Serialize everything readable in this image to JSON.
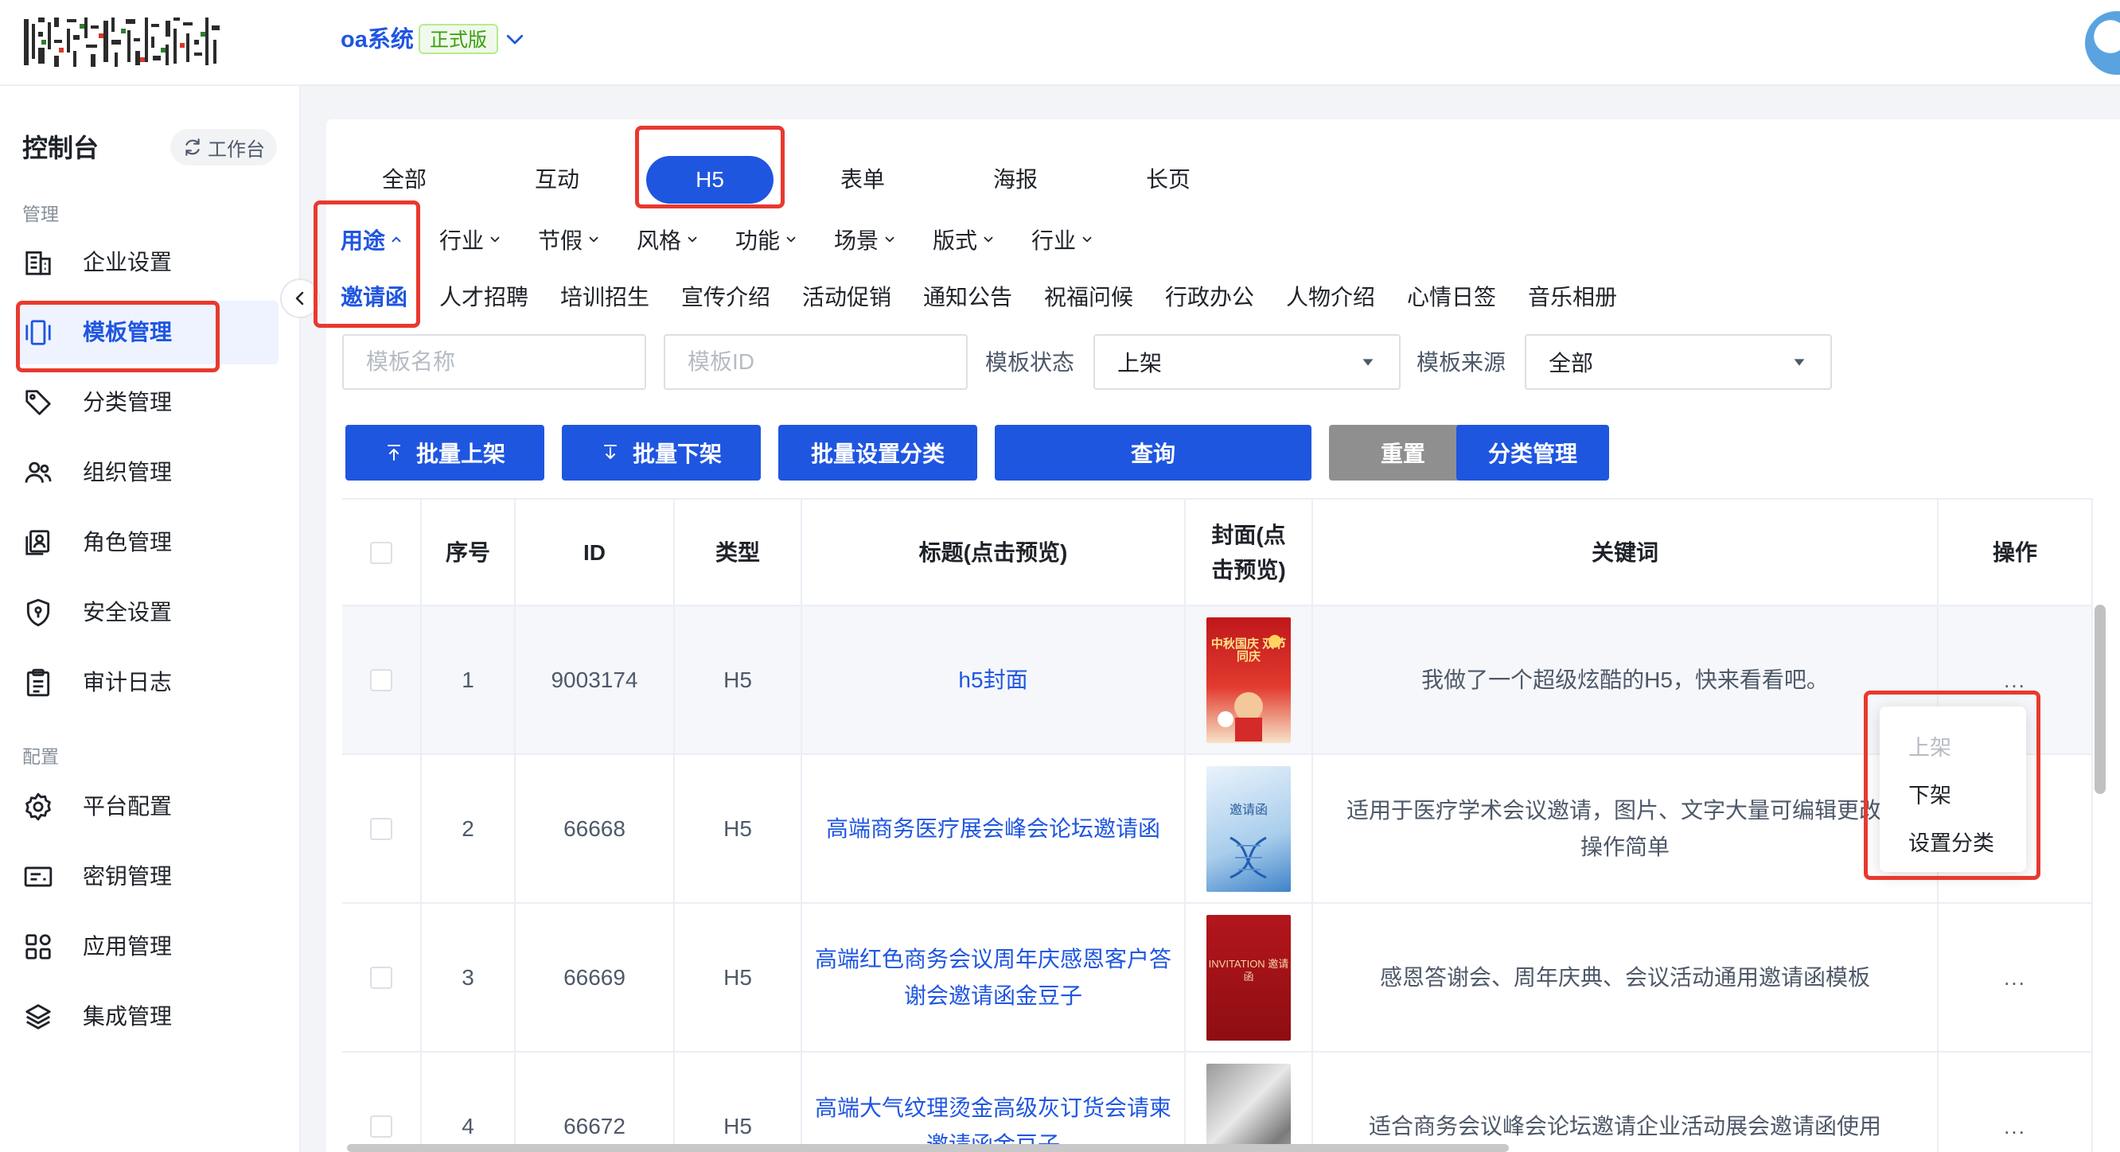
{
  "header": {
    "app_name": "oa系统",
    "edition_badge": "正式版"
  },
  "sidebar": {
    "title": "控制台",
    "workbench_label": "工作台",
    "sections": {
      "manage_label": "管理",
      "config_label": "配置"
    },
    "items": [
      {
        "label": "企业设置",
        "icon": "building-icon"
      },
      {
        "label": "模板管理",
        "icon": "template-icon",
        "active": true
      },
      {
        "label": "分类管理",
        "icon": "tag-icon"
      },
      {
        "label": "组织管理",
        "icon": "users-icon"
      },
      {
        "label": "角色管理",
        "icon": "role-icon"
      },
      {
        "label": "安全设置",
        "icon": "shield-icon"
      },
      {
        "label": "审计日志",
        "icon": "clipboard-icon"
      },
      {
        "label": "平台配置",
        "icon": "gear-icon"
      },
      {
        "label": "密钥管理",
        "icon": "key-card-icon"
      },
      {
        "label": "应用管理",
        "icon": "apps-icon"
      },
      {
        "label": "集成管理",
        "icon": "layers-icon"
      }
    ]
  },
  "type_tabs": [
    {
      "label": "全部"
    },
    {
      "label": "互动"
    },
    {
      "label": "H5",
      "active": true
    },
    {
      "label": "表单"
    },
    {
      "label": "海报"
    },
    {
      "label": "长页"
    }
  ],
  "filter_dropdowns": [
    {
      "label": "用途",
      "active": true
    },
    {
      "label": "行业"
    },
    {
      "label": "节假"
    },
    {
      "label": "风格"
    },
    {
      "label": "功能"
    },
    {
      "label": "场景"
    },
    {
      "label": "版式"
    },
    {
      "label": "行业"
    }
  ],
  "sub_tags": [
    {
      "label": "邀请函",
      "active": true
    },
    {
      "label": "人才招聘"
    },
    {
      "label": "培训招生"
    },
    {
      "label": "宣传介绍"
    },
    {
      "label": "活动促销"
    },
    {
      "label": "通知公告"
    },
    {
      "label": "祝福问候"
    },
    {
      "label": "行政办公"
    },
    {
      "label": "人物介绍"
    },
    {
      "label": "心情日签"
    },
    {
      "label": "音乐相册"
    }
  ],
  "search": {
    "name_placeholder": "模板名称",
    "id_placeholder": "模板ID",
    "status_label": "模板状态",
    "status_value": "上架",
    "source_label": "模板来源",
    "source_value": "全部"
  },
  "actions": {
    "batch_on": "批量上架",
    "batch_off": "批量下架",
    "batch_category": "批量设置分类",
    "query": "查询",
    "reset": "重置",
    "category_manage": "分类管理"
  },
  "table": {
    "columns": {
      "seq": "序号",
      "id": "ID",
      "type": "类型",
      "title": "标题(点击预览)",
      "cover": "封面(点击预览)",
      "keywords": "关键词",
      "ops": "操作"
    },
    "rows": [
      {
        "seq": "1",
        "id": "9003174",
        "type": "H5",
        "title": "h5封面",
        "keywords": "我做了一个超级炫酷的H5，快来看看吧。",
        "ops": "...",
        "cover_text": "中秋国庆 双节同庆"
      },
      {
        "seq": "2",
        "id": "66668",
        "type": "H5",
        "title": "高端商务医疗展会峰会论坛邀请函",
        "keywords": "适用于医疗学术会议邀请，图片、文字大量可编辑更改，操作简单",
        "ops": "",
        "cover_text": "邀请函"
      },
      {
        "seq": "3",
        "id": "66669",
        "type": "H5",
        "title": "高端红色商务会议周年庆感恩客户答谢会邀请函金豆子",
        "keywords": "感恩答谢会、周年庆典、会议活动通用邀请函模板",
        "ops": "...",
        "cover_text": "INVITATION 邀请函"
      },
      {
        "seq": "4",
        "id": "66672",
        "type": "H5",
        "title": "高端大气纹理烫金高级灰订货会请柬邀请函金豆子",
        "keywords": "适合商务会议峰会论坛邀请企业活动展会邀请函使用",
        "ops": "...",
        "cover_text": ""
      }
    ]
  },
  "op_menu": {
    "items": [
      {
        "label": "上架",
        "disabled": true
      },
      {
        "label": "下架"
      },
      {
        "label": "设置分类"
      }
    ]
  },
  "colors": {
    "primary": "#1f56e0",
    "reset_gray": "#8f8f8f",
    "annotation_red": "#e8392f",
    "edition_green": "#389e0d"
  }
}
